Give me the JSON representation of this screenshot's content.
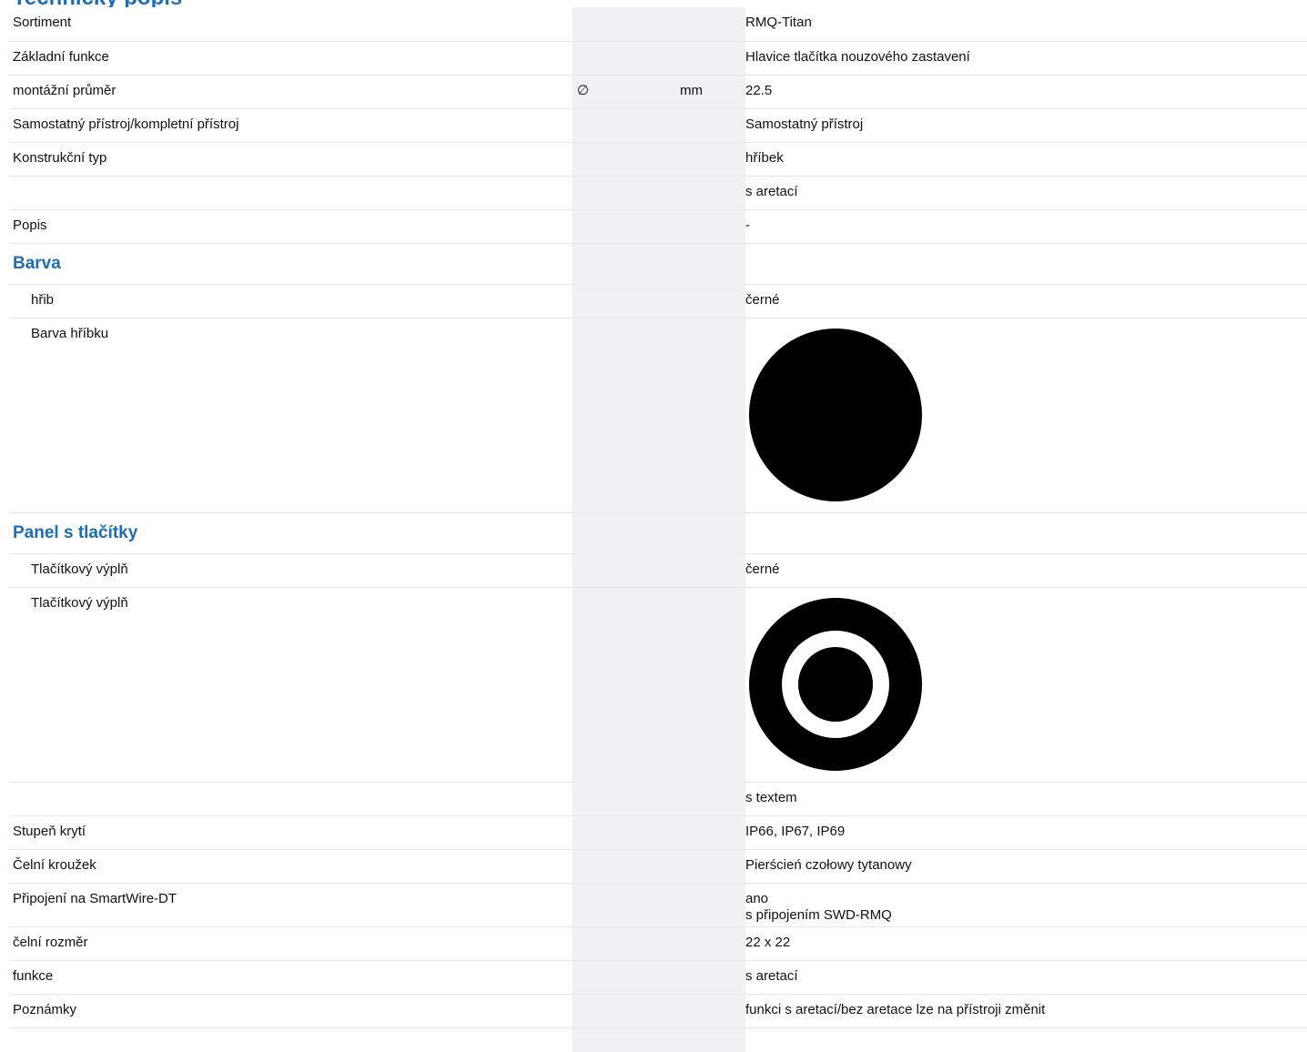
{
  "header": {
    "title": "Technický popis"
  },
  "rows": {
    "sortiment": {
      "label": "Sortiment",
      "value": "RMQ-Titan"
    },
    "zakladni_funkce": {
      "label": "Základní funkce",
      "value": "Hlavice tlačítka nouzového zastavení"
    },
    "montazni_prumer": {
      "label": "montážní průměr",
      "symbol": "∅",
      "unit": "mm",
      "value": "22.5"
    },
    "samostatny": {
      "label": "Samostatný přístroj/kompletní přístroj",
      "value": "Samostatný přístroj"
    },
    "konstrukcni_typ": {
      "label": "Konstrukční typ",
      "value": "hříbek"
    },
    "konstrukcni_typ_2": {
      "label": "",
      "value": "s aretací"
    },
    "popis": {
      "label": "Popis",
      "value": "-"
    },
    "barva_section": {
      "title": "Barva"
    },
    "hrib": {
      "label": "hřib",
      "value": "černé"
    },
    "barva_hribku": {
      "label": "Barva hříbku",
      "icon": "black-circle-swatch-icon",
      "color": "#000000"
    },
    "panel_section": {
      "title": "Panel s tlačítky"
    },
    "tlacitkovy_vypln_1": {
      "label": "Tlačítkový výplň",
      "value": "černé"
    },
    "tlacitkovy_vypln_2": {
      "label": "Tlačítkový výplň",
      "icon": "black-ring-target-icon",
      "color": "#000000"
    },
    "s_textem": {
      "label": "",
      "value": "s textem"
    },
    "stupen_kryti": {
      "label": "Stupeň krytí",
      "value": "IP66, IP67, IP69"
    },
    "celni_krouzek": {
      "label": "Čelní kroužek",
      "value": "Pierścień czołowy tytanowy"
    },
    "pripojeni": {
      "label": "Připojení na SmartWire-DT",
      "value_line1": "ano",
      "value_line2": "s připojením SWD-RMQ"
    },
    "celni_rozmer": {
      "label": "čelní rozměr",
      "value": "22 x 22"
    },
    "funkce": {
      "label": "funkce",
      "value": "s aretací"
    },
    "poznamky": {
      "label": "Poznámky",
      "value": "funkci s aretací/bez aretace lze na přístroji změnit"
    }
  }
}
